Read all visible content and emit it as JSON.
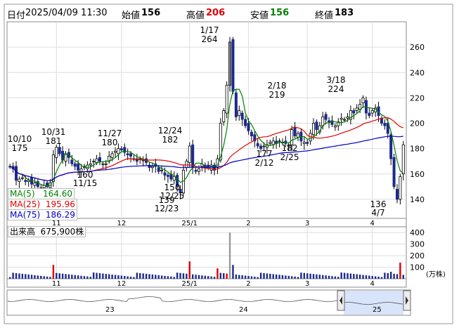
{
  "ohlc": {
    "date_label": "日付",
    "date_value": "2025/04/09 11:30",
    "open_label": "始値",
    "open_value": "156",
    "high_label": "高値",
    "high_value": "206",
    "low_label": "安値",
    "low_value": "156",
    "close_label": "終値",
    "close_value": "183"
  },
  "ma_legend": [
    {
      "label": "MA(5)",
      "value": "164.60",
      "color": "#008000"
    },
    {
      "label": "MA(25)",
      "value": "195.96",
      "color": "#e00000"
    },
    {
      "label": "MA(75)",
      "value": "186.29",
      "color": "#0000c8"
    }
  ],
  "volume_label": "出来高",
  "volume_value": "675,900株",
  "volume_unit": "(万株)",
  "price_ticks": [
    "260",
    "240",
    "220",
    "200",
    "180",
    "160",
    "140"
  ],
  "volume_ticks": [
    "400",
    "300",
    "200",
    "100"
  ],
  "month_ticks": [
    "11",
    "12",
    "25/1",
    "2",
    "3",
    "4"
  ],
  "navigator_years": [
    "23",
    "24",
    "25"
  ],
  "annotations": {
    "a1": "10/10",
    "a1v": "175",
    "a2": "10/31",
    "a2v": "181",
    "a3": "11/27",
    "a3v": "180",
    "a4": "12/24",
    "a4v": "182",
    "a5": "1/17",
    "a5v": "264",
    "a6": "2/18",
    "a6v": "219",
    "a7": "3/18",
    "a7v": "224",
    "a8v": "160",
    "a8": "11/15",
    "a9v": "150",
    "a9": "12/25",
    "a10v": "139",
    "a10": "12/23",
    "a11v": "177",
    "a11": "2/12",
    "a12v": "182",
    "a12": "2/25",
    "a13v": "136",
    "a13": "4/7"
  },
  "chart_data": {
    "type": "candlestick",
    "ylim": [
      125,
      280
    ],
    "volume_ylim": [
      0,
      450
    ],
    "bars": 128,
    "close": [
      166,
      164,
      155,
      156,
      157,
      154,
      155,
      152,
      153,
      150,
      149,
      151,
      150,
      153,
      175,
      181,
      176,
      171,
      176,
      173,
      168,
      166,
      163,
      164,
      166,
      167,
      168,
      170,
      172,
      170,
      168,
      168,
      174,
      176,
      178,
      180,
      179,
      177,
      175,
      174,
      172,
      170,
      172,
      171,
      169,
      165,
      166,
      166,
      162,
      163,
      159,
      158,
      156,
      158,
      150,
      145,
      163,
      170,
      182,
      165,
      162,
      164,
      168,
      166,
      165,
      167,
      163,
      172,
      200,
      210,
      230,
      264,
      225,
      205,
      210,
      203,
      198,
      194,
      190,
      186,
      182,
      180,
      182,
      183,
      185,
      186,
      184,
      186,
      185,
      184,
      183,
      195,
      190,
      192,
      186,
      185,
      184,
      192,
      200,
      195,
      198,
      205,
      203,
      201,
      199,
      198,
      201,
      204,
      203,
      205,
      210,
      208,
      212,
      215,
      220,
      208,
      206,
      210,
      212,
      206,
      200,
      198,
      192,
      172,
      150,
      140,
      158,
      183
    ],
    "ma5_tail_value": 164.6,
    "ma25_tail_value": 195.96,
    "ma75_tail_value": 186.29
  }
}
